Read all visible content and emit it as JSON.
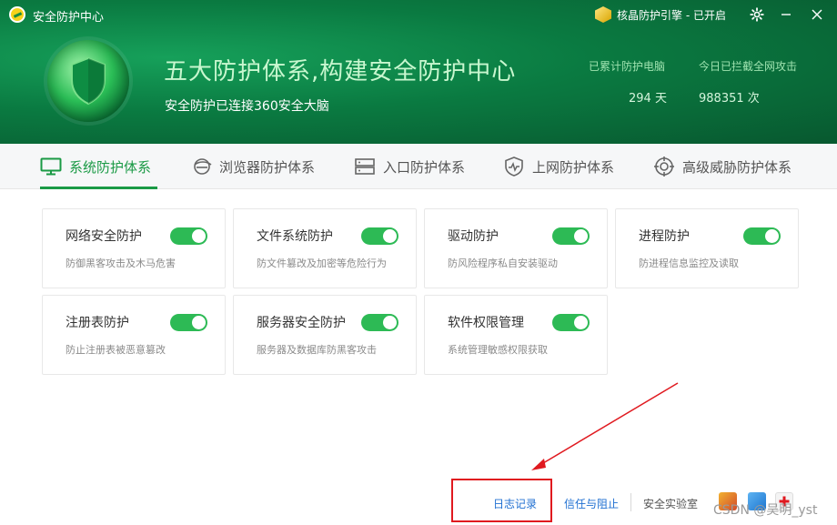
{
  "window": {
    "title": "安全防护中心",
    "engine_status": "核晶防护引擎 - 已开启"
  },
  "header": {
    "headline": "五大防护体系,构建安全防护中心",
    "subline": "安全防护已连接360安全大脑",
    "stats": [
      {
        "label": "已累计防护电脑",
        "value": "294 天"
      },
      {
        "label": "今日已拦截全网攻击",
        "value": "988351 次"
      }
    ]
  },
  "tabs": [
    {
      "label": "系统防护体系",
      "icon": "monitor-icon",
      "active": true
    },
    {
      "label": "浏览器防护体系",
      "icon": "browser-icon",
      "active": false
    },
    {
      "label": "入口防护体系",
      "icon": "server-icon",
      "active": false
    },
    {
      "label": "上网防护体系",
      "icon": "shield-pulse-icon",
      "active": false
    },
    {
      "label": "高级威胁防护体系",
      "icon": "target-icon",
      "active": false
    }
  ],
  "cards": [
    {
      "title": "网络安全防护",
      "desc": "防御黑客攻击及木马危害",
      "enabled": true
    },
    {
      "title": "文件系统防护",
      "desc": "防文件篡改及加密等危险行为",
      "enabled": true
    },
    {
      "title": "驱动防护",
      "desc": "防风险程序私自安装驱动",
      "enabled": true
    },
    {
      "title": "进程防护",
      "desc": "防进程信息监控及读取",
      "enabled": true
    },
    {
      "title": "注册表防护",
      "desc": "防止注册表被恶意篡改",
      "enabled": true
    },
    {
      "title": "服务器安全防护",
      "desc": "服务器及数据库防黑客攻击",
      "enabled": true
    },
    {
      "title": "软件权限管理",
      "desc": "系统管理敏感权限获取",
      "enabled": true
    }
  ],
  "footer": {
    "log": "日志记录",
    "trust": "信任与阻止",
    "lab": "安全实验室"
  },
  "watermark": "CSDN @吴明_yst",
  "colors": {
    "accent": "#1a9a45",
    "toggle_on": "#2dba55",
    "link": "#1f6fd1",
    "annotation": "#e0191f"
  }
}
